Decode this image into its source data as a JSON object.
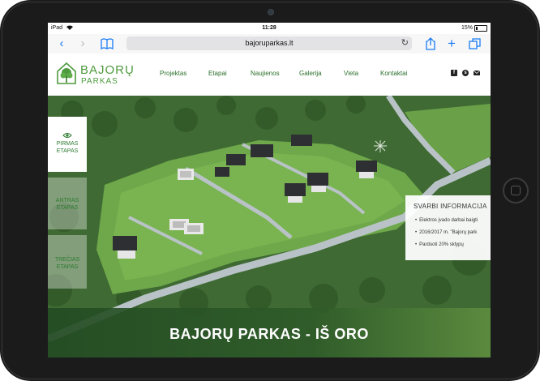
{
  "status_bar": {
    "carrier": "iPad",
    "time": "11:28",
    "battery": "15%"
  },
  "browser": {
    "url": "bajoruparkas.lt",
    "icons": [
      "back-icon",
      "forward-icon",
      "bookmarks-icon",
      "reload-icon",
      "share-icon",
      "new-tab-icon",
      "tabs-icon"
    ]
  },
  "logo": {
    "title": "BAJORŲ",
    "subtitle": "PARKAS"
  },
  "nav": {
    "items": [
      "Projektas",
      "Etapai",
      "Naujienos",
      "Galerija",
      "Vieta",
      "Kontaktai"
    ]
  },
  "social": [
    "facebook-icon",
    "skype-icon",
    "email-icon"
  ],
  "tabs": [
    {
      "line1": "PIRMAS",
      "line2": "ETAPAS",
      "active": true
    },
    {
      "line1": "ANTRAS",
      "line2": "ETAPAS",
      "active": false
    },
    {
      "line1": "TREČIAS",
      "line2": "ETAPAS",
      "active": false
    }
  ],
  "info": {
    "title": "SVARBI INFORMACIJA",
    "items": [
      "Elektros įvado darbai baigti",
      "2016/2017 m. \"Bajorų park",
      "Parduoti 20% sklypų"
    ]
  },
  "banner": {
    "title": "BAJORŲ PARKAS - IŠ ORO"
  },
  "colors": {
    "brand_green": "#4e9b3e",
    "nav_text": "#2a6f2a",
    "browser_accent": "#1a7cf5"
  }
}
